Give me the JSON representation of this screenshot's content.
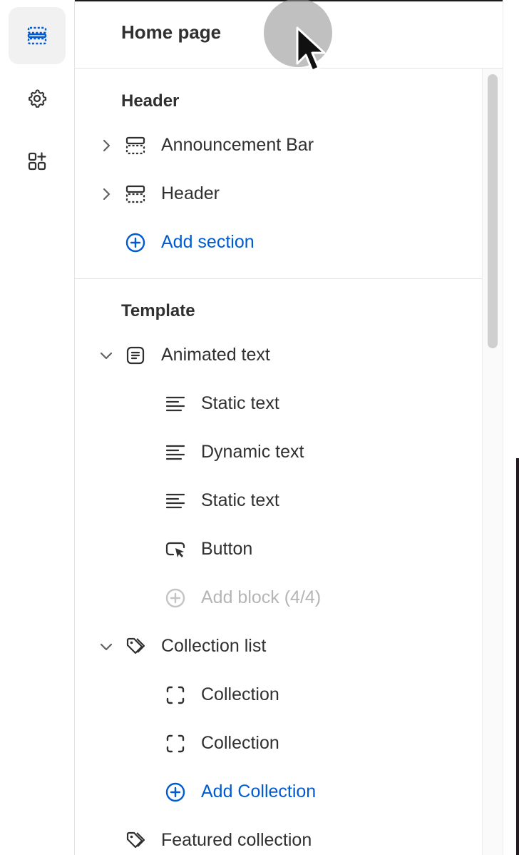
{
  "app": {
    "page_title": "Home page"
  },
  "rail": {
    "items": [
      {
        "icon": "sections-icon",
        "active": true
      },
      {
        "icon": "gear-icon",
        "active": false
      },
      {
        "icon": "apps-add-icon",
        "active": false
      }
    ]
  },
  "header_group": {
    "title": "Header",
    "items": [
      {
        "label": "Announcement Bar",
        "icon": "section-layout-icon",
        "expanded": false
      },
      {
        "label": "Header",
        "icon": "section-layout-icon",
        "expanded": false
      }
    ],
    "add_label": "Add section"
  },
  "template_group": {
    "title": "Template",
    "animated_text": {
      "label": "Animated text",
      "icon": "text-block-icon",
      "blocks": [
        {
          "label": "Static text",
          "icon": "text-lines-icon"
        },
        {
          "label": "Dynamic text",
          "icon": "text-lines-icon"
        },
        {
          "label": "Static text",
          "icon": "text-lines-icon"
        },
        {
          "label": "Button",
          "icon": "button-pointer-icon"
        }
      ],
      "add_block_label": "Add block (4/4)"
    },
    "collection_list": {
      "label": "Collection list",
      "icon": "tag-icon",
      "blocks": [
        {
          "label": "Collection",
          "icon": "dashed-square-icon"
        },
        {
          "label": "Collection",
          "icon": "dashed-square-icon"
        }
      ],
      "add_label": "Add Collection"
    },
    "featured_collection": {
      "label": "Featured collection",
      "icon": "tag-icon"
    }
  },
  "colors": {
    "accent": "#005bd3",
    "text": "#303030",
    "muted": "#b5b5b5"
  }
}
